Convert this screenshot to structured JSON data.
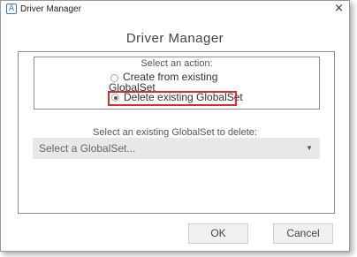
{
  "window": {
    "title": "Driver Manager",
    "app_icon_letter": "A",
    "close_glyph": "×"
  },
  "dialog": {
    "heading": "Driver Manager",
    "action_label": "Select an action:",
    "options": [
      {
        "label": "Create from existing GlobalSet",
        "selected": false
      },
      {
        "label": "Delete existing GlobalSet",
        "selected": true
      }
    ],
    "select_label": "Select an existing GlobalSet to delete:",
    "select_placeholder": "Select a GlobalSet...",
    "select_arrow": "▼",
    "ok_label": "OK",
    "cancel_label": "Cancel"
  },
  "colors": {
    "highlight": "#d32f2f",
    "app_icon": "#3a6fd8"
  }
}
